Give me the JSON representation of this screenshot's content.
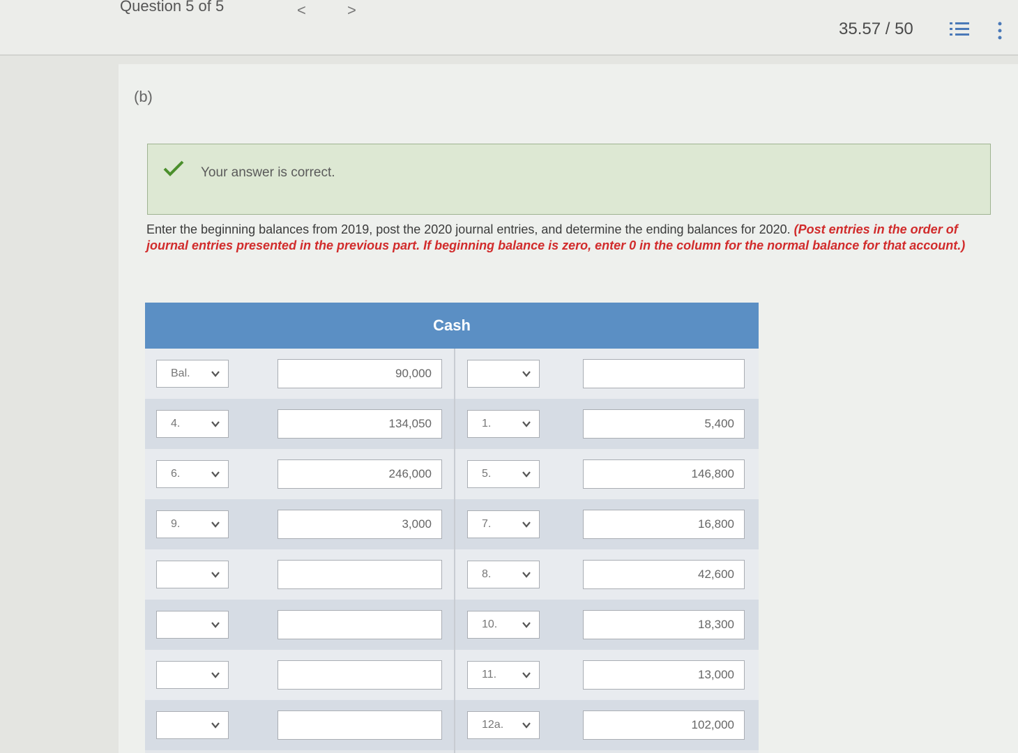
{
  "header": {
    "question_label": "Question 5 of 5",
    "prev_arrow": "<",
    "next_arrow": ">",
    "score": "35.57 / 50",
    "icons": [
      "list-icon",
      "more-vertical-icon"
    ]
  },
  "part": {
    "label": "(b)"
  },
  "feedback": {
    "text": "Your answer is correct.",
    "color": "#dde8d3",
    "icon": "check-icon"
  },
  "instructions": {
    "plain": "Enter the beginning balances from 2019, post the 2020 journal entries, and determine the ending balances for 2020.",
    "emphasis": "(Post entries in the order of journal entries presented in the previous part. If beginning balance is zero, enter 0 in the column for the normal balance for that account.)"
  },
  "t_account": {
    "title": "Cash",
    "header_color": "#5b8fc4",
    "rows": [
      {
        "debit_ref": "Bal.",
        "debit_amount": "90,000",
        "credit_ref": "",
        "credit_amount": ""
      },
      {
        "debit_ref": "4.",
        "debit_amount": "134,050",
        "credit_ref": "1.",
        "credit_amount": "5,400"
      },
      {
        "debit_ref": "6.",
        "debit_amount": "246,000",
        "credit_ref": "5.",
        "credit_amount": "146,800"
      },
      {
        "debit_ref": "9.",
        "debit_amount": "3,000",
        "credit_ref": "7.",
        "credit_amount": "16,800"
      },
      {
        "debit_ref": "",
        "debit_amount": "",
        "credit_ref": "8.",
        "credit_amount": "42,600"
      },
      {
        "debit_ref": "",
        "debit_amount": "",
        "credit_ref": "10.",
        "credit_amount": "18,300"
      },
      {
        "debit_ref": "",
        "debit_amount": "",
        "credit_ref": "11.",
        "credit_amount": "13,000"
      },
      {
        "debit_ref": "",
        "debit_amount": "",
        "credit_ref": "12a.",
        "credit_amount": "102,000"
      }
    ]
  }
}
